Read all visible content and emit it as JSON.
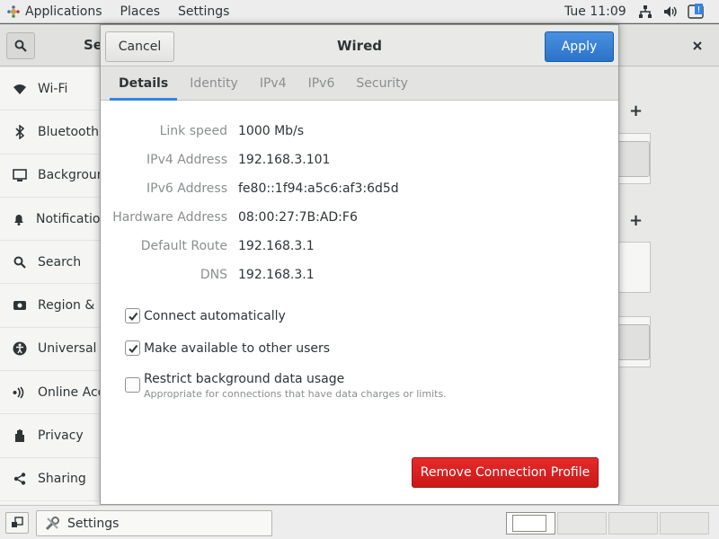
{
  "topbar": {
    "menus": [
      "Applications",
      "Places",
      "Settings"
    ],
    "clock": "Tue 11:09",
    "tray_icons": [
      "network-icon",
      "volume-icon",
      "power-icon"
    ]
  },
  "settings_window": {
    "title": "Se",
    "sidebar": [
      {
        "label": "Wi-Fi",
        "icon": "wifi-icon"
      },
      {
        "label": "Bluetooth",
        "icon": "bluetooth-icon"
      },
      {
        "label": "Background",
        "icon": "background-icon"
      },
      {
        "label": "Notifications",
        "icon": "notifications-icon"
      },
      {
        "label": "Search",
        "icon": "search-icon"
      },
      {
        "label": "Region & Language",
        "icon": "region-icon"
      },
      {
        "label": "Universal Access",
        "icon": "universal-access-icon"
      },
      {
        "label": "Online Accounts",
        "icon": "online-accounts-icon"
      },
      {
        "label": "Privacy",
        "icon": "privacy-icon"
      },
      {
        "label": "Sharing",
        "icon": "sharing-icon"
      }
    ]
  },
  "dialog": {
    "title": "Wired",
    "cancel_label": "Cancel",
    "apply_label": "Apply",
    "tabs": [
      {
        "label": "Details",
        "active": true
      },
      {
        "label": "Identity",
        "active": false
      },
      {
        "label": "IPv4",
        "active": false
      },
      {
        "label": "IPv6",
        "active": false
      },
      {
        "label": "Security",
        "active": false
      }
    ],
    "details": [
      {
        "label": "Link speed",
        "value": "1000 Mb/s"
      },
      {
        "label": "IPv4 Address",
        "value": "192.168.3.101"
      },
      {
        "label": "IPv6 Address",
        "value": "fe80::1f94:a5c6:af3:6d5d"
      },
      {
        "label": "Hardware Address",
        "value": "08:00:27:7B:AD:F6"
      },
      {
        "label": "Default Route",
        "value": "192.168.3.1"
      },
      {
        "label": "DNS",
        "value": "192.168.3.1"
      }
    ],
    "options": [
      {
        "label": "Connect automatically",
        "checked": true,
        "sub": ""
      },
      {
        "label": "Make available to other users",
        "checked": true,
        "sub": ""
      },
      {
        "label": "Restrict background data usage",
        "checked": false,
        "sub": "Appropriate for connections that have data charges or limits."
      }
    ],
    "remove_label": "Remove Connection Profile"
  },
  "taskbar": {
    "task_label": "Settings",
    "workspaces": 4,
    "active_workspace": 1
  },
  "colors": {
    "accent": "#3584e4",
    "apply": "#2b73c8",
    "destructive": "#cc1818"
  }
}
